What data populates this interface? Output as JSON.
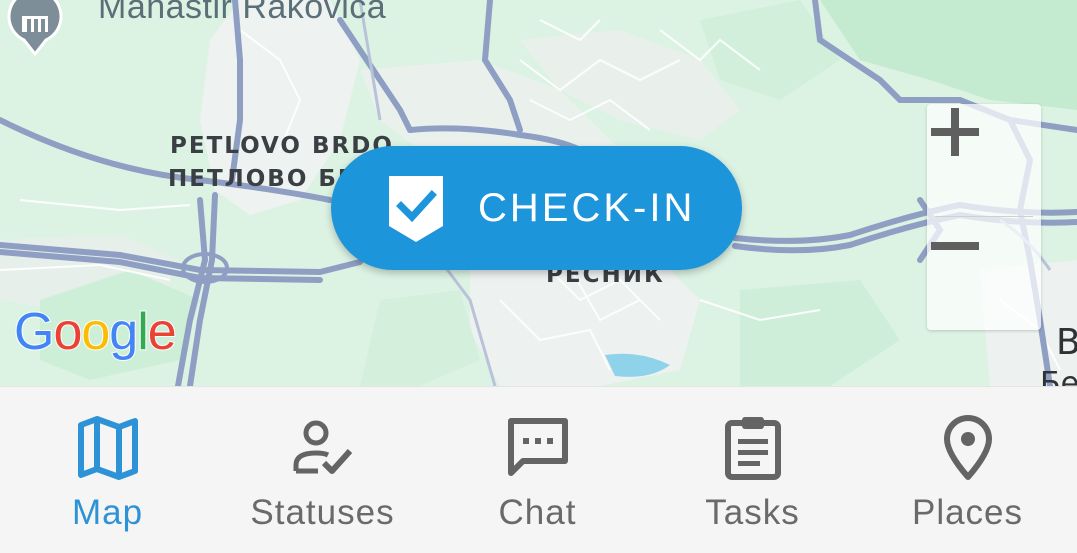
{
  "map": {
    "title": "Manastir Rakovica",
    "labels": {
      "petlovo_latin": "PETLOVO BRDO",
      "petlovo_cyr": "ПЕТЛОВО БРДО",
      "resnik": "РЕСНИК",
      "edge_b": "B",
      "edge_be": "Бе"
    },
    "attribution": "Google",
    "zoom_in_icon": "plus-icon",
    "zoom_out_icon": "minus-icon"
  },
  "checkin": {
    "label": "CHECK-IN",
    "icon": "shield-check-icon",
    "color": "#1d95db"
  },
  "nav": {
    "active": "map",
    "active_color": "#2e93d6",
    "items": [
      {
        "id": "map",
        "label": "Map",
        "icon": "map-icon"
      },
      {
        "id": "statuses",
        "label": "Statuses",
        "icon": "user-check-icon"
      },
      {
        "id": "chat",
        "label": "Chat",
        "icon": "chat-bubble-icon"
      },
      {
        "id": "tasks",
        "label": "Tasks",
        "icon": "clipboard-icon"
      },
      {
        "id": "places",
        "label": "Places",
        "icon": "place-pin-icon"
      }
    ]
  }
}
